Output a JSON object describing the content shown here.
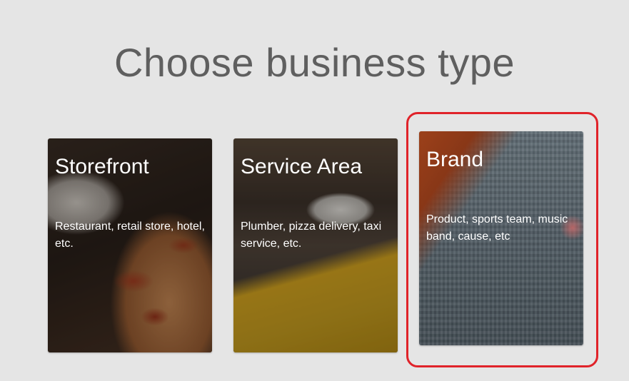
{
  "page": {
    "title": "Choose business type"
  },
  "cards": [
    {
      "id": "storefront",
      "title": "Storefront",
      "description": "Restaurant, retail store, hotel, etc."
    },
    {
      "id": "service-area",
      "title": "Service Area",
      "description": "Plumber, pizza delivery, taxi service, etc."
    },
    {
      "id": "brand",
      "title": "Brand",
      "description": "Product, sports team, music band, cause, etc"
    }
  ],
  "colors": {
    "background": "#e5e5e5",
    "title_text": "#5f5f5f",
    "card_text": "#ffffff",
    "highlight": "#e0232a"
  }
}
